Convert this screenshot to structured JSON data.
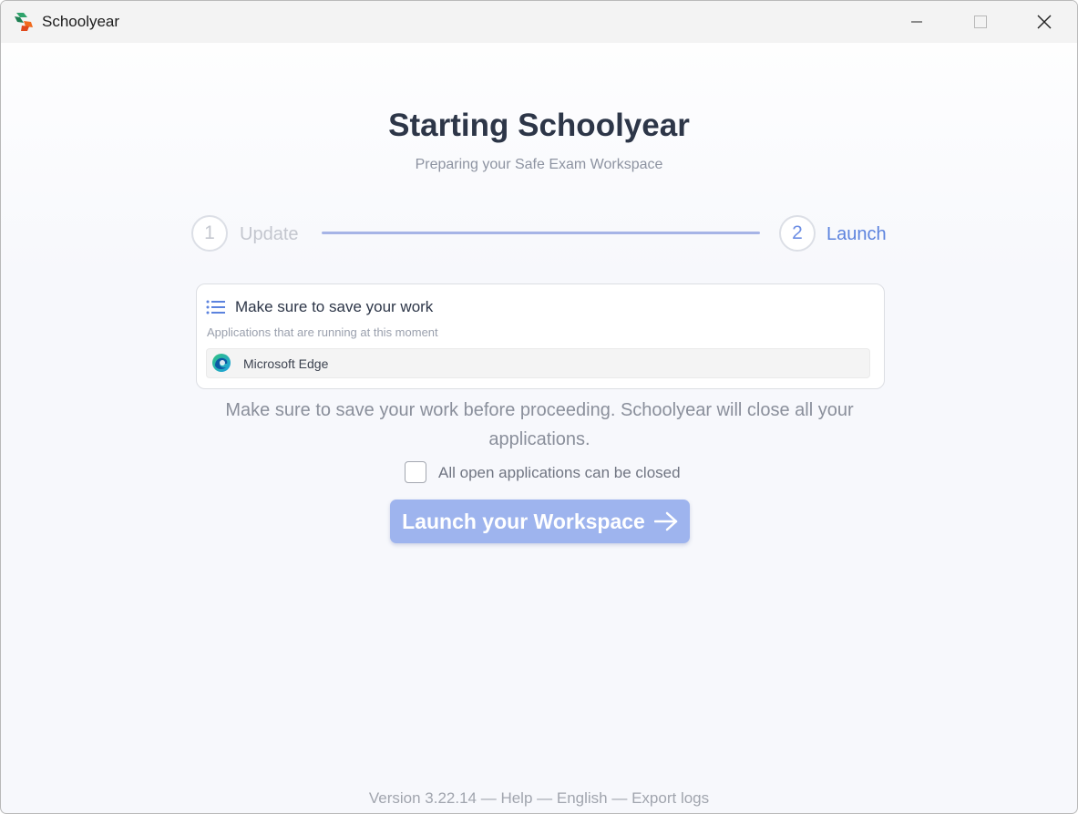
{
  "window": {
    "title": "Schoolyear"
  },
  "header": {
    "title": "Starting Schoolyear",
    "subtitle": "Preparing your Safe Exam Workspace"
  },
  "stepper": {
    "steps": [
      {
        "number": "1",
        "label": "Update",
        "state": "complete"
      },
      {
        "number": "2",
        "label": "Launch",
        "state": "active"
      }
    ]
  },
  "card": {
    "title": "Make sure to save your work",
    "subtitle": "Applications that are running at this moment",
    "apps": [
      {
        "name": "Microsoft Edge",
        "icon": "edge-icon"
      }
    ]
  },
  "warning": {
    "text": "Make sure to save your work before proceeding. Schoolyear will close all your applications."
  },
  "confirm": {
    "checked": false,
    "label": "All open applications can be closed"
  },
  "launch_button": {
    "label": "Launch your Workspace"
  },
  "footer": {
    "version": "Version 3.22.14",
    "separator": " — ",
    "help": "Help",
    "language": "English",
    "export": "Export logs"
  },
  "colors": {
    "accent": "#5c83de",
    "button_disabled": "#9eb4ee",
    "title": "#2d3648"
  }
}
